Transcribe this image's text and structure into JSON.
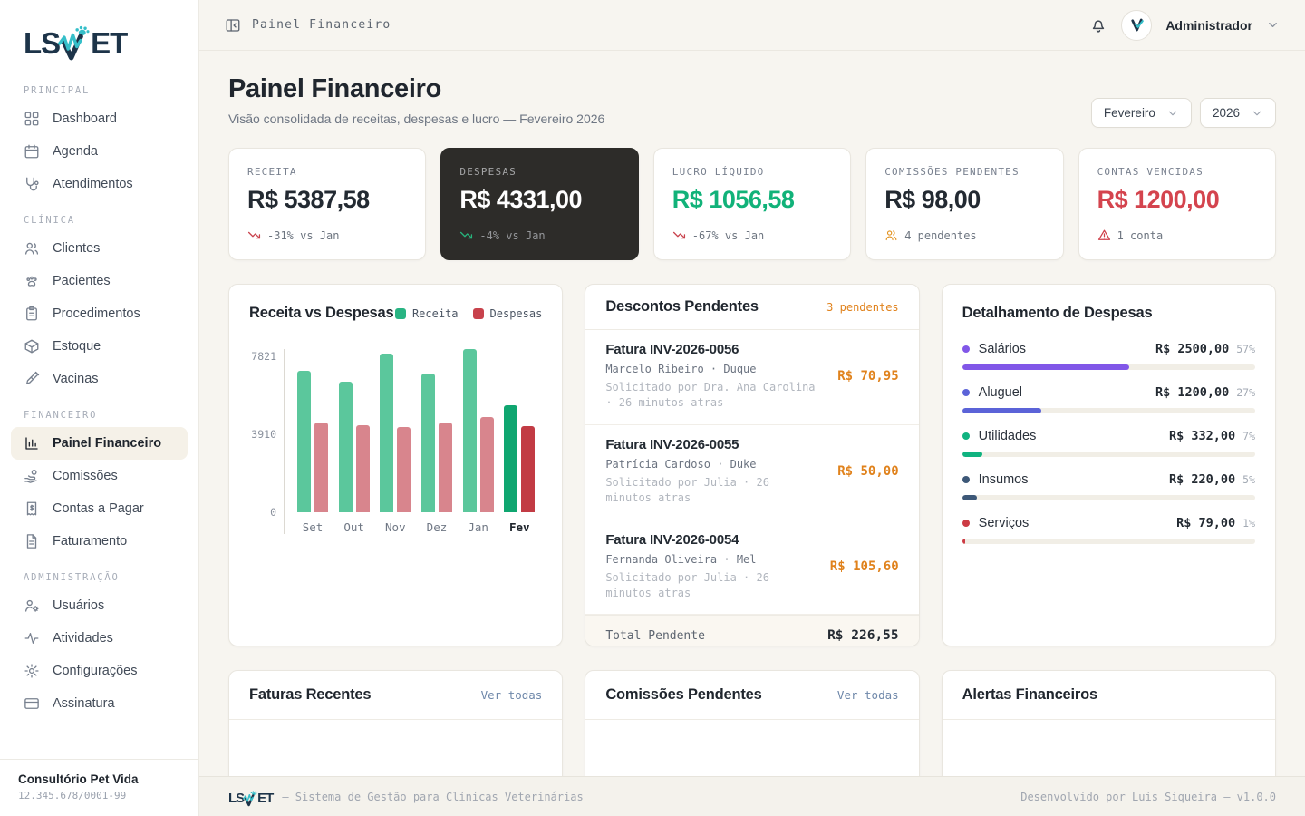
{
  "brand": {
    "prefix": "LS",
    "suffix": "ET"
  },
  "sidebar": {
    "sections": [
      {
        "label": "PRINCIPAL",
        "items": [
          {
            "label": "Dashboard",
            "icon": "grid",
            "active": false
          },
          {
            "label": "Agenda",
            "icon": "calendar",
            "active": false
          },
          {
            "label": "Atendimentos",
            "icon": "stethoscope",
            "active": false
          }
        ]
      },
      {
        "label": "CLÍNICA",
        "items": [
          {
            "label": "Clientes",
            "icon": "users",
            "active": false
          },
          {
            "label": "Pacientes",
            "icon": "paw",
            "active": false
          },
          {
            "label": "Procedimentos",
            "icon": "clipboard",
            "active": false
          },
          {
            "label": "Estoque",
            "icon": "box",
            "active": false
          },
          {
            "label": "Vacinas",
            "icon": "syringe",
            "active": false
          }
        ]
      },
      {
        "label": "FINANCEIRO",
        "items": [
          {
            "label": "Painel Financeiro",
            "icon": "bar-chart",
            "active": true
          },
          {
            "label": "Comissões",
            "icon": "hand-coins",
            "active": false
          },
          {
            "label": "Contas a Pagar",
            "icon": "receipt",
            "active": false
          },
          {
            "label": "Faturamento",
            "icon": "file-text",
            "active": false
          }
        ]
      },
      {
        "label": "ADMINISTRAÇÃO",
        "items": [
          {
            "label": "Usuários",
            "icon": "user-cog",
            "active": false
          },
          {
            "label": "Atividades",
            "icon": "activity",
            "active": false
          },
          {
            "label": "Configurações",
            "icon": "settings",
            "active": false
          },
          {
            "label": "Assinatura",
            "icon": "credit-card",
            "active": false
          }
        ]
      }
    ],
    "org": {
      "name": "Consultório Pet Vida",
      "cnpj": "12.345.678/0001-99"
    }
  },
  "topbar": {
    "breadcrumb": "Painel Financeiro",
    "user": "Administrador"
  },
  "header": {
    "title": "Painel Financeiro",
    "subtitle": "Visão consolidada de receitas, despesas e lucro — Fevereiro 2026",
    "month": "Fevereiro",
    "year": "2026"
  },
  "kpis": [
    {
      "label": "RECEITA",
      "value": "R$ 5387,58",
      "value_color": "#232a32",
      "trend": "-31% vs Jan",
      "trend_icon": "trending-down",
      "trend_icon_color": "#c9434d",
      "variant": "light"
    },
    {
      "label": "DESPESAS",
      "value": "R$ 4331,00",
      "value_color": "#ffffff",
      "trend": "-4% vs Jan",
      "trend_icon": "trending-down",
      "trend_icon_color": "#27b47c",
      "variant": "dark"
    },
    {
      "label": "LUCRO LÍQUIDO",
      "value": "R$ 1056,58",
      "value_color": "#11b279",
      "trend": "-67% vs Jan",
      "trend_icon": "trending-down",
      "trend_icon_color": "#c9434d",
      "variant": "light"
    },
    {
      "label": "COMISSÕES PENDENTES",
      "value": "R$ 98,00",
      "value_color": "#232a32",
      "trend": "4 pendentes",
      "trend_icon": "users",
      "trend_icon_color": "#e2921f",
      "variant": "light"
    },
    {
      "label": "CONTAS VENCIDAS",
      "value": "R$ 1200,00",
      "value_color": "#d4444e",
      "trend": "1 conta",
      "trend_icon": "alert-triangle",
      "trend_icon_color": "#cf3f49",
      "variant": "light"
    }
  ],
  "chart_data": {
    "type": "bar",
    "title": "Receita vs Despesas",
    "categories": [
      "Set",
      "Out",
      "Nov",
      "Dez",
      "Jan",
      "Fev"
    ],
    "series": [
      {
        "name": "Receita",
        "values": [
          7100,
          6580,
          7980,
          6950,
          8200,
          5388
        ]
      },
      {
        "name": "Despesas",
        "values": [
          4490,
          4380,
          4290,
          4490,
          4770,
          4331
        ]
      }
    ],
    "y_ticks": [
      7821,
      3910,
      0
    ],
    "ymax": 8200,
    "highlight_index": 5,
    "xlabel": "",
    "ylabel": "",
    "colors": {
      "receita": "#5bc79c",
      "despesas": "#d8858d",
      "receita_current": "#0fa670",
      "despesas_current": "#c23b44",
      "legend_receita": "#29b483",
      "legend_despesas": "#c8424c"
    }
  },
  "descontos": {
    "title": "Descontos Pendentes",
    "badge": "3 pendentes",
    "items": [
      {
        "title": "Fatura INV-2026-0056",
        "client": "Marcelo Ribeiro · Duque",
        "note": "Solicitado por Dra. Ana Carolina · 26 minutos atras",
        "amount": "R$ 70,95"
      },
      {
        "title": "Fatura INV-2026-0055",
        "client": "Patrícia Cardoso · Duke",
        "note": "Solicitado por Julia · 26 minutos atras",
        "amount": "R$ 50,00"
      },
      {
        "title": "Fatura INV-2026-0054",
        "client": "Fernanda Oliveira · Mel",
        "note": "Solicitado por Julia · 26 minutos atras",
        "amount": "R$ 105,60"
      }
    ],
    "total_label": "Total Pendente",
    "total_value": "R$ 226,55"
  },
  "expenses": {
    "title": "Detalhamento de Despesas",
    "rows": [
      {
        "name": "Salários",
        "amount": "R$ 2500,00",
        "pct": "57%",
        "pct_value": 57,
        "color": "#8157e8"
      },
      {
        "name": "Aluguel",
        "amount": "R$ 1200,00",
        "pct": "27%",
        "pct_value": 27,
        "color": "#5b63d8"
      },
      {
        "name": "Utilidades",
        "amount": "R$ 332,00",
        "pct": "7%",
        "pct_value": 7,
        "color": "#10b380"
      },
      {
        "name": "Insumos",
        "amount": "R$ 220,00",
        "pct": "5%",
        "pct_value": 5,
        "color": "#3d5878"
      },
      {
        "name": "Serviços",
        "amount": "R$ 79,00",
        "pct": "1%",
        "pct_value": 1,
        "color": "#cc3b44"
      }
    ]
  },
  "bottom_cards": [
    {
      "title": "Faturas Recentes",
      "link": "Ver todas"
    },
    {
      "title": "Comissões Pendentes",
      "link": "Ver todas"
    },
    {
      "title": "Alertas Financeiros",
      "link": ""
    }
  ],
  "footer": {
    "tagline": "— Sistema de Gestão para Clínicas Veterinárias",
    "credits": "Desenvolvido por Luis Siqueira — v1.0.0"
  }
}
